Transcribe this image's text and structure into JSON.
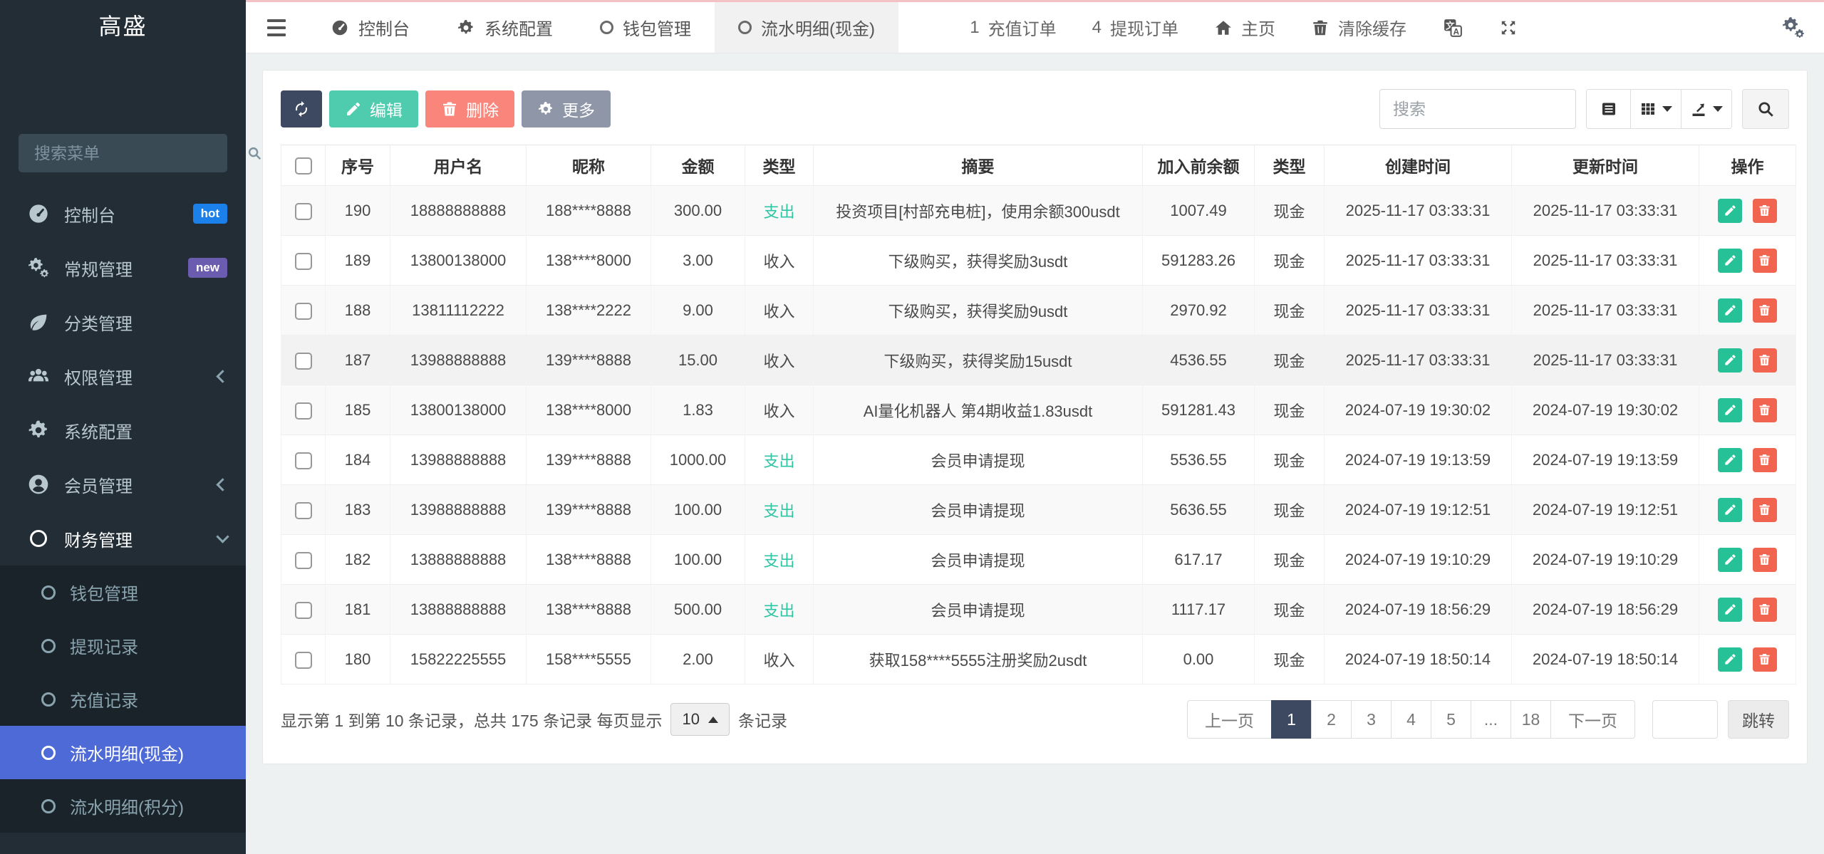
{
  "logo": "高盛",
  "colors": {
    "accent": "#4d6ad6",
    "dark": "#3d4861",
    "green": "#4fcbad",
    "green_deep": "#26c196",
    "red": "#f9857b",
    "red_deep": "#f06450",
    "gray_btn": "#8e96a8",
    "badge_hot": "#1b80ea",
    "badge_new": "#6b5caf",
    "type_out": "#2dc5a4"
  },
  "sidebar": {
    "search_placeholder": "搜索菜单",
    "items": [
      {
        "label": "控制台",
        "icon": "tachometer-icon",
        "badge": "hot"
      },
      {
        "label": "常规管理",
        "icon": "gears-icon",
        "badge": "new"
      },
      {
        "label": "分类管理",
        "icon": "leaf-icon"
      },
      {
        "label": "权限管理",
        "icon": "users-icon",
        "chevron": "left"
      },
      {
        "label": "系统配置",
        "icon": "gear-icon"
      },
      {
        "label": "会员管理",
        "icon": "user-circle-icon",
        "chevron": "left"
      },
      {
        "label": "财务管理",
        "icon": "circle-icon",
        "chevron": "down",
        "expanded": true
      }
    ],
    "submenu": [
      {
        "label": "钱包管理",
        "active": false
      },
      {
        "label": "提现记录",
        "active": false
      },
      {
        "label": "充值记录",
        "active": false
      },
      {
        "label": "流水明细(现金)",
        "active": true
      },
      {
        "label": "流水明细(积分)",
        "active": false
      }
    ]
  },
  "topbar": {
    "tabs": [
      {
        "label": "控制台",
        "icon": "tachometer-icon",
        "active": false
      },
      {
        "label": "系统配置",
        "icon": "gear-icon",
        "active": false
      },
      {
        "label": "钱包管理",
        "icon": "circle-icon",
        "active": false
      },
      {
        "label": "流水明细(现金)",
        "icon": "circle-icon",
        "active": true
      }
    ],
    "right": [
      {
        "count": "1",
        "label": "充值订单"
      },
      {
        "count": "4",
        "label": "提现订单"
      },
      {
        "label": "主页",
        "icon": "home-icon"
      },
      {
        "label": "清除缓存",
        "icon": "trash-icon"
      }
    ]
  },
  "toolbar": {
    "edit_label": "编辑",
    "delete_label": "删除",
    "more_label": "更多",
    "search_placeholder": "搜索"
  },
  "table": {
    "columns": [
      "序号",
      "用户名",
      "昵称",
      "金额",
      "类型",
      "摘要",
      "加入前余额",
      "类型",
      "创建时间",
      "更新时间",
      "操作"
    ],
    "rows": [
      {
        "seq": "190",
        "username": "18888888888",
        "nickname": "188****8888",
        "amount": "300.00",
        "type": "支出",
        "direction": "out",
        "summary": "投资项目[村部充电桩]，使用余额300usdt",
        "balance": "1007.49",
        "fund": "现金",
        "created": "2025-11-17 03:33:31",
        "updated": "2025-11-17 03:33:31",
        "hover": false
      },
      {
        "seq": "189",
        "username": "13800138000",
        "nickname": "138****8000",
        "amount": "3.00",
        "type": "收入",
        "direction": "in",
        "summary": "下级购买，获得奖励3usdt",
        "balance": "591283.26",
        "fund": "现金",
        "created": "2025-11-17 03:33:31",
        "updated": "2025-11-17 03:33:31",
        "hover": false
      },
      {
        "seq": "188",
        "username": "13811112222",
        "nickname": "138****2222",
        "amount": "9.00",
        "type": "收入",
        "direction": "in",
        "summary": "下级购买，获得奖励9usdt",
        "balance": "2970.92",
        "fund": "现金",
        "created": "2025-11-17 03:33:31",
        "updated": "2025-11-17 03:33:31",
        "hover": false
      },
      {
        "seq": "187",
        "username": "13988888888",
        "nickname": "139****8888",
        "amount": "15.00",
        "type": "收入",
        "direction": "in",
        "summary": "下级购买，获得奖励15usdt",
        "balance": "4536.55",
        "fund": "现金",
        "created": "2025-11-17 03:33:31",
        "updated": "2025-11-17 03:33:31",
        "hover": true
      },
      {
        "seq": "185",
        "username": "13800138000",
        "nickname": "138****8000",
        "amount": "1.83",
        "type": "收入",
        "direction": "in",
        "summary": "AI量化机器人 第4期收益1.83usdt",
        "balance": "591281.43",
        "fund": "现金",
        "created": "2024-07-19 19:30:02",
        "updated": "2024-07-19 19:30:02",
        "hover": false
      },
      {
        "seq": "184",
        "username": "13988888888",
        "nickname": "139****8888",
        "amount": "1000.00",
        "type": "支出",
        "direction": "out",
        "summary": "会员申请提现",
        "balance": "5536.55",
        "fund": "现金",
        "created": "2024-07-19 19:13:59",
        "updated": "2024-07-19 19:13:59",
        "hover": false
      },
      {
        "seq": "183",
        "username": "13988888888",
        "nickname": "139****8888",
        "amount": "100.00",
        "type": "支出",
        "direction": "out",
        "summary": "会员申请提现",
        "balance": "5636.55",
        "fund": "现金",
        "created": "2024-07-19 19:12:51",
        "updated": "2024-07-19 19:12:51",
        "hover": false
      },
      {
        "seq": "182",
        "username": "13888888888",
        "nickname": "138****8888",
        "amount": "100.00",
        "type": "支出",
        "direction": "out",
        "summary": "会员申请提现",
        "balance": "617.17",
        "fund": "现金",
        "created": "2024-07-19 19:10:29",
        "updated": "2024-07-19 19:10:29",
        "hover": false
      },
      {
        "seq": "181",
        "username": "13888888888",
        "nickname": "138****8888",
        "amount": "500.00",
        "type": "支出",
        "direction": "out",
        "summary": "会员申请提现",
        "balance": "1117.17",
        "fund": "现金",
        "created": "2024-07-19 18:56:29",
        "updated": "2024-07-19 18:56:29",
        "hover": false
      },
      {
        "seq": "180",
        "username": "15822225555",
        "nickname": "158****5555",
        "amount": "2.00",
        "type": "收入",
        "direction": "in",
        "summary": "获取158****5555注册奖励2usdt",
        "balance": "0.00",
        "fund": "现金",
        "created": "2024-07-19 18:50:14",
        "updated": "2024-07-19 18:50:14",
        "hover": false
      }
    ]
  },
  "footer": {
    "summary_prefix": "显示第 1 到第 10 条记录，总共 175 条记录 每页显示",
    "page_size": "10",
    "summary_suffix": "条记录",
    "pagination": [
      "上一页",
      "1",
      "2",
      "3",
      "4",
      "5",
      "...",
      "18",
      "下一页"
    ],
    "jump_label": "跳转"
  }
}
